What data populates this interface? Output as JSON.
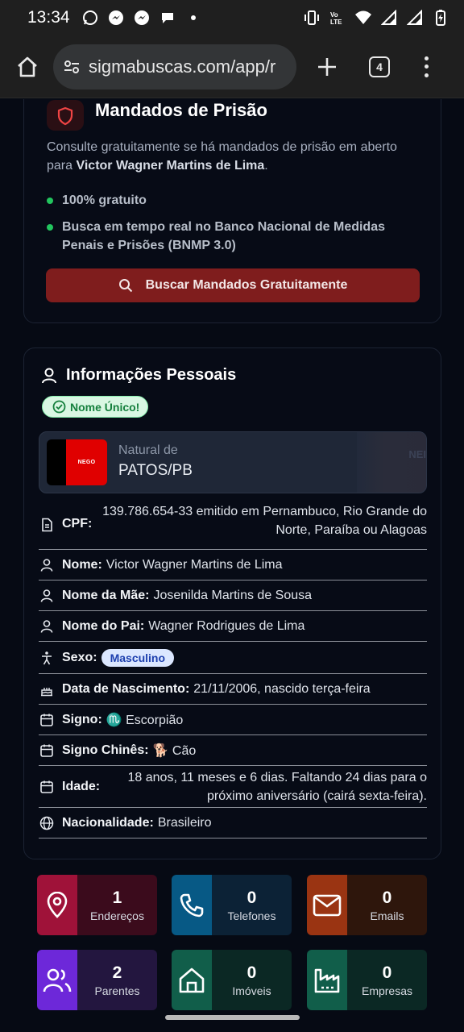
{
  "status": {
    "time": "13:34"
  },
  "browser": {
    "url": "sigmabuscas.com/app/r",
    "tab_count": "4"
  },
  "warrant": {
    "title": "Mandados de Prisão",
    "desc_prefix": "Consulte gratuitamente se há mandados de prisão em aberto para ",
    "desc_name": "Victor Wagner Martins de Lima",
    "desc_suffix": ".",
    "bullets": [
      "100% gratuito",
      "Busca em tempo real no Banco Nacional de Medidas Penais e Prisões (BNMP 3.0)"
    ],
    "button_label": "Buscar Mandados Gratuitamente"
  },
  "personal": {
    "title": "Informações Pessoais",
    "unique_badge": "Nome Único!",
    "natural_label": "Natural de",
    "natural_value": "PATOS/PB",
    "flag_text": "NEGO",
    "faded_text": "NEI",
    "rows": {
      "cpf_label": "CPF:",
      "cpf_value": "139.786.654-33 emitido em Pernambuco, Rio Grande do Norte, Paraíba ou Alagoas",
      "name_label": "Nome:",
      "name_value": "Victor Wagner Martins de Lima",
      "mother_label": "Nome da Mãe:",
      "mother_value": "Josenilda Martins de Sousa",
      "father_label": "Nome do Pai:",
      "father_value": "Wagner Rodrigues de Lima",
      "sex_label": "Sexo:",
      "sex_value": "Masculino",
      "birth_label": "Data de Nascimento:",
      "birth_value": "21/11/2006, nascido terça-feira",
      "sign_label": "Signo:",
      "sign_value": "♏ Escorpião",
      "chinese_label": "Signo Chinês:",
      "chinese_value": "🐕 Cão",
      "age_label": "Idade:",
      "age_value": "18 anos, 11 meses e 6 dias. Faltando 24 dias para o próximo aniversário (cairá sexta-feira).",
      "nationality_label": "Nacionalidade:",
      "nationality_value": "Brasileiro"
    }
  },
  "tiles": [
    {
      "num": "1",
      "label": "Endereços",
      "icon": "map-pin-icon"
    },
    {
      "num": "0",
      "label": "Telefones",
      "icon": "phone-icon"
    },
    {
      "num": "0",
      "label": "Emails",
      "icon": "mail-icon"
    },
    {
      "num": "2",
      "label": "Parentes",
      "icon": "users-icon"
    },
    {
      "num": "0",
      "label": "Imóveis",
      "icon": "home-icon"
    },
    {
      "num": "0",
      "label": "Empresas",
      "icon": "factory-icon"
    }
  ],
  "colors": {
    "tile_enderecos": [
      "#9f1239",
      "#3b0b1c"
    ],
    "tile_telefones": [
      "#075985",
      "#0c2236"
    ],
    "tile_emails": [
      "#9a3412",
      "#2e160c"
    ],
    "tile_parentes": [
      "#6d28d9",
      "#23163f"
    ],
    "tile_imoveis": [
      "#115e4a",
      "#0b2824"
    ],
    "tile_empresas": [
      "#115e4a",
      "#0b2824"
    ]
  }
}
